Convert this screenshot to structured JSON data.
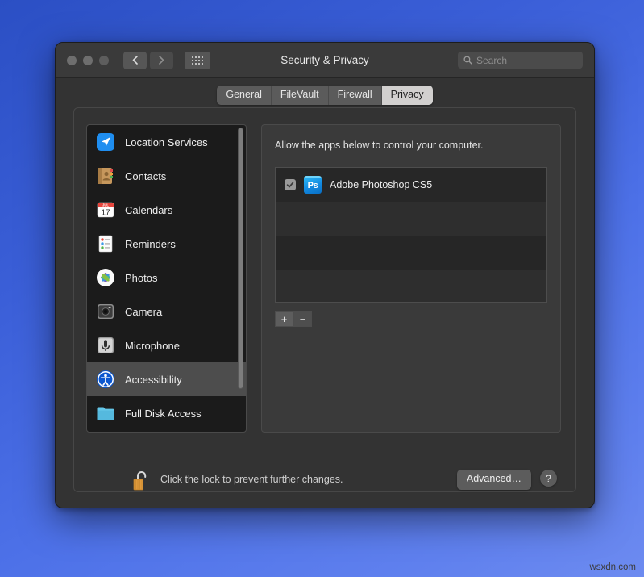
{
  "desktop": {
    "watermark": "wsxdn.com"
  },
  "window": {
    "title": "Security & Privacy",
    "traffic_lights": [
      {
        "name": "close",
        "color": "#6e6e6e"
      },
      {
        "name": "minimize",
        "color": "#6e6e6e"
      },
      {
        "name": "zoom",
        "color": "#5d5d5d"
      }
    ],
    "nav": {
      "back_glyph": "‹",
      "forward_glyph": "›"
    },
    "grid_button": "show-all-icon",
    "search": {
      "placeholder": "Search",
      "value": "",
      "icon": "search-icon"
    }
  },
  "tabs": [
    {
      "label": "General",
      "active": false
    },
    {
      "label": "FileVault",
      "active": false
    },
    {
      "label": "Firewall",
      "active": false
    },
    {
      "label": "Privacy",
      "active": true
    }
  ],
  "sidebar": {
    "items": [
      {
        "label": "Location Services",
        "icon": "location-services-icon",
        "selected": false
      },
      {
        "label": "Contacts",
        "icon": "contacts-icon",
        "selected": false
      },
      {
        "label": "Calendars",
        "icon": "calendars-icon",
        "selected": false
      },
      {
        "label": "Reminders",
        "icon": "reminders-icon",
        "selected": false
      },
      {
        "label": "Photos",
        "icon": "photos-icon",
        "selected": false
      },
      {
        "label": "Camera",
        "icon": "camera-icon",
        "selected": false
      },
      {
        "label": "Microphone",
        "icon": "microphone-icon",
        "selected": false
      },
      {
        "label": "Accessibility",
        "icon": "accessibility-icon",
        "selected": true
      },
      {
        "label": "Full Disk Access",
        "icon": "full-disk-access-icon",
        "selected": false
      }
    ],
    "calendar_icon": {
      "month": "JUL",
      "day": "17"
    }
  },
  "main": {
    "caption": "Allow the apps below to control your computer.",
    "apps": [
      {
        "name": "Adobe Photoshop CS5",
        "checked": true,
        "icon_label": "Ps"
      }
    ],
    "add_button": "+",
    "remove_button": "−"
  },
  "footer": {
    "lock_icon": "unlocked-padlock-icon",
    "lock_message": "Click the lock to prevent further changes.",
    "advanced_label": "Advanced…",
    "help_label": "?"
  }
}
